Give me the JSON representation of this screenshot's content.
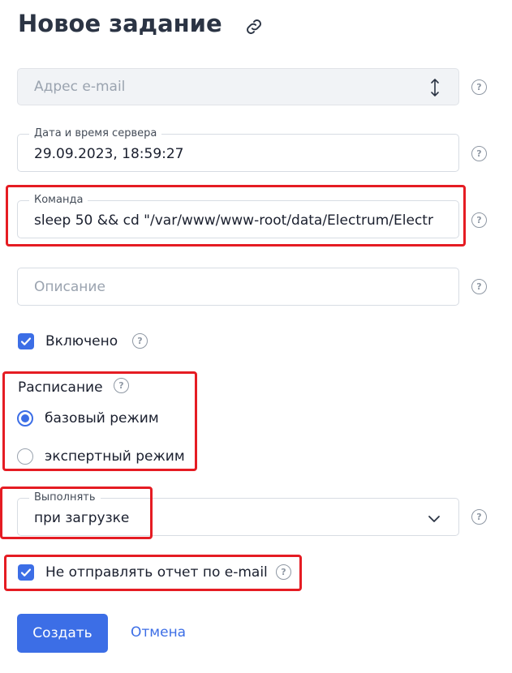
{
  "page": {
    "title": "Новое задание"
  },
  "email": {
    "placeholder": "Адрес e-mail"
  },
  "server_datetime": {
    "label": "Дата и время сервера",
    "value": "29.09.2023, 18:59:27"
  },
  "command": {
    "label": "Команда",
    "value": "sleep 50 && cd \"/var/www/www-root/data/Electrum/Electr"
  },
  "description": {
    "placeholder": "Описание"
  },
  "enabled": {
    "label": "Включено",
    "checked": true
  },
  "schedule": {
    "label": "Расписание",
    "options": [
      {
        "label": "базовый режим",
        "selected": true
      },
      {
        "label": "экспертный режим",
        "selected": false
      }
    ]
  },
  "run": {
    "label": "Выполнять",
    "value": "при загрузке"
  },
  "no_email_report": {
    "label": "Не отправлять отчет по e-mail",
    "checked": true
  },
  "actions": {
    "create": "Создать",
    "cancel": "Отмена"
  },
  "help_glyph": "?",
  "colors": {
    "accent": "#3c6ee6",
    "highlight": "#e51c23"
  }
}
